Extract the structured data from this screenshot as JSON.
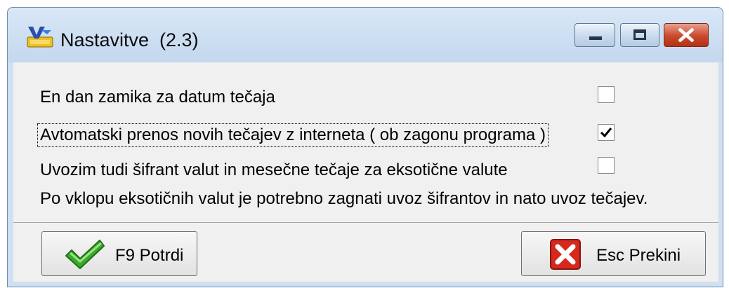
{
  "window": {
    "title": "Nastavitve  (2.3)",
    "app_icon": "app-icon"
  },
  "options": [
    {
      "label": "En dan zamika za datum tečaja",
      "checked": false
    },
    {
      "label": "Avtomatski prenos novih tečajev z interneta ( ob zagonu programa )",
      "checked": true
    },
    {
      "label": "Uvozim tudi šifrant valut in mesečne tečaje za eksotične valute",
      "checked": false
    }
  ],
  "note": "Po vklopu eksotičnih valut je potrebno zagnati uvoz šifrantov in nato uvoz tečajev.",
  "buttons": {
    "confirm_label": "F9 Potrdi",
    "cancel_label": "Esc Prekini"
  },
  "colors": {
    "title_bar": "#cfe0f2",
    "client_bg": "#f0f0f0",
    "close_button": "#c9492c",
    "confirm_icon": "#3aaa2a",
    "cancel_icon": "#d42a1e"
  }
}
